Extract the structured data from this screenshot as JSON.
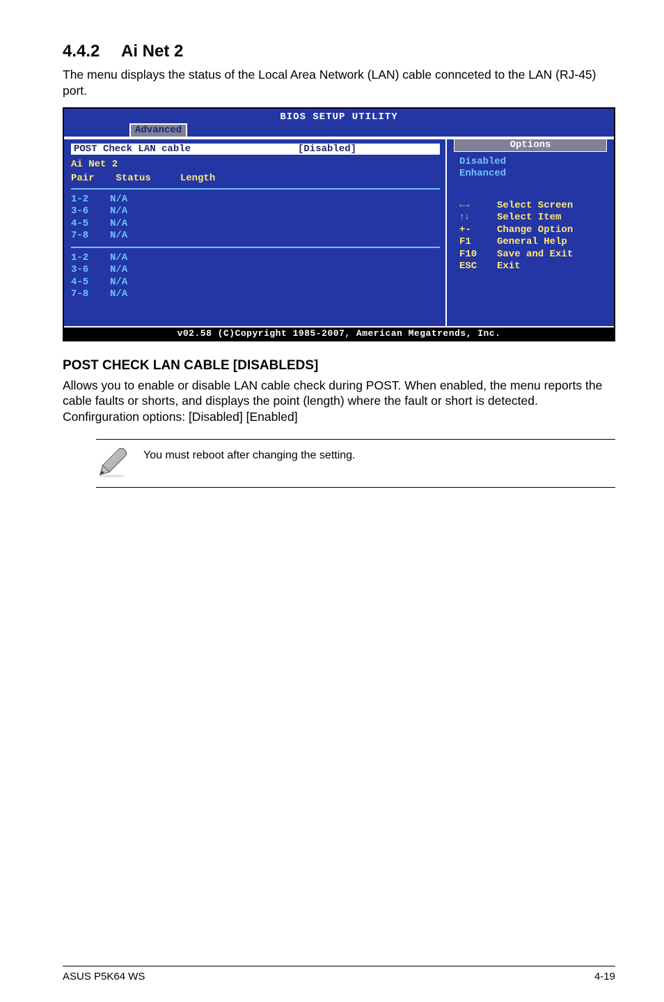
{
  "section": {
    "number": "4.4.2",
    "title": "Ai Net 2"
  },
  "intro": "The menu displays the status of the Local Area Network (LAN) cable connceted to the LAN (RJ-45) port.",
  "bios": {
    "title": "BIOS SETUP UTILITY",
    "tab": "Advanced",
    "selected": {
      "label": "POST Check LAN cable",
      "value": "[Disabled]"
    },
    "left_title": "Ai Net 2",
    "cols": {
      "c1": "Pair",
      "c2": "Status",
      "c3": "Length"
    },
    "rows_a": [
      {
        "pair": "1-2",
        "status": "N/A"
      },
      {
        "pair": "3-6",
        "status": "N/A"
      },
      {
        "pair": "4-5",
        "status": "N/A"
      },
      {
        "pair": "7-8",
        "status": "N/A"
      }
    ],
    "rows_b": [
      {
        "pair": "1-2",
        "status": "N/A"
      },
      {
        "pair": "3-6",
        "status": "N/A"
      },
      {
        "pair": "4-5",
        "status": "N/A"
      },
      {
        "pair": "7-8",
        "status": "N/A"
      }
    ],
    "right": {
      "options_label": "Options",
      "opt1": "Disabled",
      "opt2": "Enhanced",
      "help": [
        {
          "k": "←→",
          "v": "Select Screen"
        },
        {
          "k": "↑↓",
          "v": "Select Item"
        },
        {
          "k": "+-",
          "v": "Change Option"
        },
        {
          "k": "F1",
          "v": "General Help"
        },
        {
          "k": "F10",
          "v": "Save and Exit"
        },
        {
          "k": "ESC",
          "v": "Exit"
        }
      ]
    },
    "footer": "v02.58 (C)Copyright 1985-2007, American Megatrends, Inc."
  },
  "sub": {
    "heading": "POST CHECK LAN CABLE [DISABLEDS]",
    "body": "Allows you to enable or disable LAN cable check during POST. When enabled, the menu reports the cable faults or shorts, and displays the point (length) where the fault or short is detected. Confirguration options: [Disabled] [Enabled]"
  },
  "note": "You must reboot after changing the setting.",
  "footer": {
    "left": "ASUS P5K64 WS",
    "right": "4-19"
  }
}
